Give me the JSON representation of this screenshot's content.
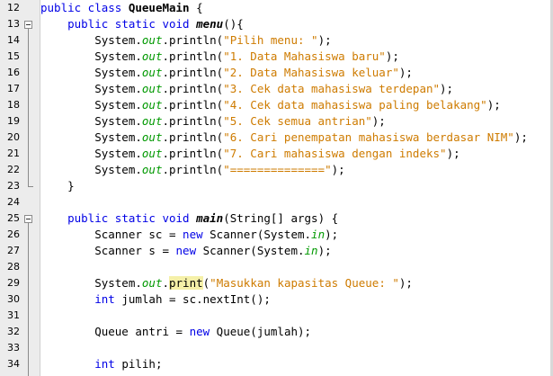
{
  "editor": {
    "lines": [
      {
        "n": "12",
        "tokens": [
          {
            "t": "public class ",
            "c": "kw"
          },
          {
            "t": "QueueMain",
            "c": "bold"
          },
          {
            "t": " {",
            "c": ""
          }
        ]
      },
      {
        "n": "13",
        "tokens": [
          {
            "t": "    ",
            "c": ""
          },
          {
            "t": "public static void ",
            "c": "kw"
          },
          {
            "t": "menu",
            "c": "bolditalic"
          },
          {
            "t": "(){",
            "c": ""
          }
        ]
      },
      {
        "n": "14",
        "tokens": [
          {
            "t": "        System.",
            "c": ""
          },
          {
            "t": "out",
            "c": "fld"
          },
          {
            "t": ".println(",
            "c": ""
          },
          {
            "t": "\"Pilih menu: \"",
            "c": "str"
          },
          {
            "t": ");",
            "c": ""
          }
        ]
      },
      {
        "n": "15",
        "tokens": [
          {
            "t": "        System.",
            "c": ""
          },
          {
            "t": "out",
            "c": "fld"
          },
          {
            "t": ".println(",
            "c": ""
          },
          {
            "t": "\"1. Data Mahasiswa baru\"",
            "c": "str"
          },
          {
            "t": ");",
            "c": ""
          }
        ]
      },
      {
        "n": "16",
        "tokens": [
          {
            "t": "        System.",
            "c": ""
          },
          {
            "t": "out",
            "c": "fld"
          },
          {
            "t": ".println(",
            "c": ""
          },
          {
            "t": "\"2. Data Mahasiswa keluar\"",
            "c": "str"
          },
          {
            "t": ");",
            "c": ""
          }
        ]
      },
      {
        "n": "17",
        "tokens": [
          {
            "t": "        System.",
            "c": ""
          },
          {
            "t": "out",
            "c": "fld"
          },
          {
            "t": ".println(",
            "c": ""
          },
          {
            "t": "\"3. Cek data mahasiswa terdepan\"",
            "c": "str"
          },
          {
            "t": ");",
            "c": ""
          }
        ]
      },
      {
        "n": "18",
        "tokens": [
          {
            "t": "        System.",
            "c": ""
          },
          {
            "t": "out",
            "c": "fld"
          },
          {
            "t": ".println(",
            "c": ""
          },
          {
            "t": "\"4. Cek data mahasiswa paling belakang\"",
            "c": "str"
          },
          {
            "t": ");",
            "c": ""
          }
        ]
      },
      {
        "n": "19",
        "tokens": [
          {
            "t": "        System.",
            "c": ""
          },
          {
            "t": "out",
            "c": "fld"
          },
          {
            "t": ".println(",
            "c": ""
          },
          {
            "t": "\"5. Cek semua antrian\"",
            "c": "str"
          },
          {
            "t": ");",
            "c": ""
          }
        ]
      },
      {
        "n": "20",
        "tokens": [
          {
            "t": "        System.",
            "c": ""
          },
          {
            "t": "out",
            "c": "fld"
          },
          {
            "t": ".println(",
            "c": ""
          },
          {
            "t": "\"6. Cari penempatan mahasiswa berdasar NIM\"",
            "c": "str"
          },
          {
            "t": ");",
            "c": ""
          }
        ]
      },
      {
        "n": "21",
        "tokens": [
          {
            "t": "        System.",
            "c": ""
          },
          {
            "t": "out",
            "c": "fld"
          },
          {
            "t": ".println(",
            "c": ""
          },
          {
            "t": "\"7. Cari mahasiswa dengan indeks\"",
            "c": "str"
          },
          {
            "t": ");",
            "c": ""
          }
        ]
      },
      {
        "n": "22",
        "tokens": [
          {
            "t": "        System.",
            "c": ""
          },
          {
            "t": "out",
            "c": "fld"
          },
          {
            "t": ".println(",
            "c": ""
          },
          {
            "t": "\"==============\"",
            "c": "str"
          },
          {
            "t": ");",
            "c": ""
          }
        ]
      },
      {
        "n": "23",
        "tokens": [
          {
            "t": "    }",
            "c": ""
          }
        ]
      },
      {
        "n": "24",
        "tokens": []
      },
      {
        "n": "25",
        "tokens": [
          {
            "t": "    ",
            "c": ""
          },
          {
            "t": "public static void ",
            "c": "kw"
          },
          {
            "t": "main",
            "c": "bolditalic"
          },
          {
            "t": "(String[] args) {",
            "c": ""
          }
        ]
      },
      {
        "n": "26",
        "tokens": [
          {
            "t": "        Scanner sc = ",
            "c": ""
          },
          {
            "t": "new",
            "c": "kw"
          },
          {
            "t": " Scanner(System.",
            "c": ""
          },
          {
            "t": "in",
            "c": "fld"
          },
          {
            "t": ");",
            "c": ""
          }
        ]
      },
      {
        "n": "27",
        "tokens": [
          {
            "t": "        Scanner s = ",
            "c": ""
          },
          {
            "t": "new",
            "c": "kw"
          },
          {
            "t": " Scanner(System.",
            "c": ""
          },
          {
            "t": "in",
            "c": "fld"
          },
          {
            "t": ");",
            "c": ""
          }
        ]
      },
      {
        "n": "28",
        "tokens": []
      },
      {
        "n": "29",
        "tokens": [
          {
            "t": "        System.",
            "c": ""
          },
          {
            "t": "out",
            "c": "fld"
          },
          {
            "t": ".",
            "c": ""
          },
          {
            "t": "print",
            "c": "hl"
          },
          {
            "t": "(",
            "c": ""
          },
          {
            "t": "\"Masukkan kapasitas Queue: \"",
            "c": "str"
          },
          {
            "t": ");",
            "c": ""
          }
        ]
      },
      {
        "n": "30",
        "tokens": [
          {
            "t": "        ",
            "c": ""
          },
          {
            "t": "int",
            "c": "kw"
          },
          {
            "t": " jumlah = sc.nextInt();",
            "c": ""
          }
        ]
      },
      {
        "n": "31",
        "tokens": []
      },
      {
        "n": "32",
        "tokens": [
          {
            "t": "        Queue antri = ",
            "c": ""
          },
          {
            "t": "new",
            "c": "kw"
          },
          {
            "t": " Queue(jumlah);",
            "c": ""
          }
        ]
      },
      {
        "n": "33",
        "tokens": []
      },
      {
        "n": "34",
        "tokens": [
          {
            "t": "        ",
            "c": ""
          },
          {
            "t": "int",
            "c": "kw"
          },
          {
            "t": " pilih;",
            "c": ""
          }
        ]
      }
    ],
    "fold_markers": [
      {
        "line": "13",
        "kind": "collapse-toggle-icon"
      },
      {
        "line": "25",
        "kind": "collapse-toggle-icon"
      }
    ]
  }
}
